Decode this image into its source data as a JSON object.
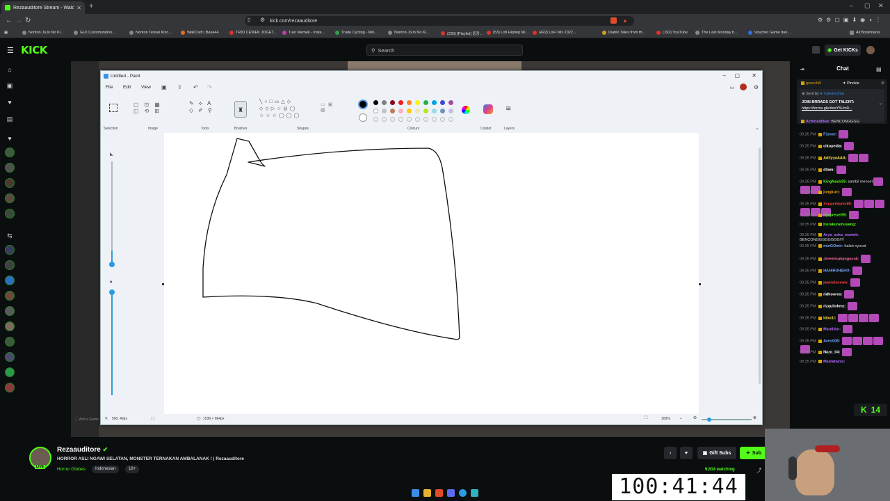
{
  "browser": {
    "tab_title": "Rezaauditore Stream - Watc",
    "url": "kick.com/rezaauditore",
    "bookmarks": [
      "Nonton JoJo No Ki...",
      "GUI Customization...",
      "Nonton Tensei Kizo...",
      "WallCraft | Base44",
      "TRIO CEWEK JOGET...",
      "Tuer Memek - Insta...",
      "Trade Cycling - Min...",
      "Nonton JoJo No Ki...",
      "(236) [Playlist] 중정...",
      "(53) Lofi Hiphop Mi...",
      "(422) LoFi Mix 2022...",
      "Diablo Tales from th...",
      "(192) YouTube",
      "The Last Monday b...",
      "Voucher Game dan..."
    ],
    "all_bookmarks": "All Bookmarks"
  },
  "kick": {
    "logo": "KICK",
    "search_placeholder": "Search",
    "get_kicks": "Get KICKs"
  },
  "paint": {
    "title": "Untitled - Paint",
    "menu": [
      "File",
      "Edit",
      "View"
    ],
    "groups": [
      "Selection",
      "Image",
      "Tools",
      "Brushes",
      "Shapes",
      "Colours",
      "Copilot",
      "Layers"
    ],
    "status_pos": "500, 49px",
    "status_size": "1536 × 864px",
    "zoom": "100%",
    "colors": [
      "#000000",
      "#7f7f7f",
      "#880015",
      "#ed1c24",
      "#ff7f27",
      "#fff200",
      "#22b14c",
      "#00a2e8",
      "#3f48cc",
      "#a349a4",
      "#ffffff",
      "#c3c3c3",
      "#b97a57",
      "#ffaec9",
      "#ffc90e",
      "#efe4b0",
      "#b5e61d",
      "#99d9ea",
      "#7092be",
      "#c8bfe7"
    ]
  },
  "chat": {
    "header": "Chat",
    "pinned_users": [
      "goonchill",
      "Pinckle"
    ],
    "pinned_sender": "Sent by",
    "pinned_text": "JOIN BRRADS GOT TALENT:",
    "pinned_link": "https://forms.gle/doxY5Um0...",
    "messages": [
      {
        "time": "",
        "user": "Achmadbkat:",
        "text": "BENCONGGGG",
        "color": "#b36bff",
        "emotes": 0
      },
      {
        "time": "09:35 PM",
        "user": "F1nxer:",
        "text": "",
        "color": "#7aa7ff",
        "emotes": 1
      },
      {
        "time": "09:35 PM",
        "user": "cikopedia:",
        "text": "",
        "color": "#fff",
        "emotes": 1
      },
      {
        "time": "09:35 PM",
        "user": "AdityyaAAA:",
        "text": "",
        "color": "#ffe14d",
        "emotes": 2
      },
      {
        "time": "09:35 PM",
        "user": "d0am:",
        "text": "",
        "color": "#fff",
        "emotes": 1
      },
      {
        "time": "09:35 PM",
        "user": "KingNasir25:",
        "text": "sambil mencet",
        "color": "#53fc18",
        "emotes": 3
      },
      {
        "time": "09:35 PM",
        "user": "jongkurr:",
        "text": "",
        "color": "#ffa500",
        "emotes": 1
      },
      {
        "time": "09:35 PM",
        "user": "XsuperSonic85:",
        "text": "",
        "color": "#ff4040",
        "emotes": 6
      },
      {
        "time": "09:35 PM",
        "user": "riyzpreset99:",
        "text": "",
        "color": "#53fc18",
        "emotes": 1
      },
      {
        "time": "09:35 PM",
        "user": "Kurakuramusang:",
        "text": "",
        "color": "#53fc18",
        "emotes": 0
      },
      {
        "time": "09:35 PM",
        "user": "Arya_suka_wowok:",
        "text": "BENCONGGGGGGGG!!!!",
        "color": "#b36bff",
        "emotes": 0
      },
      {
        "time": "09:35 PM",
        "user": "minGOmir:",
        "text": "halah nyocot",
        "color": "#7aa7ff",
        "emotes": 0
      },
      {
        "time": "09:35 PM",
        "user": "Jeremisukangocok:",
        "text": "",
        "color": "#ff6b9e",
        "emotes": 1
      },
      {
        "time": "09:35 PM",
        "user": "HAHIHUHEHO:",
        "text": "",
        "color": "#7aa7ff",
        "emotes": 1
      },
      {
        "time": "09:35 PM",
        "user": "jawirsinsewo:",
        "text": "",
        "color": "#ff4040",
        "emotes": 1
      },
      {
        "time": "09:35 PM",
        "user": "ridhooreo:",
        "text": "",
        "color": "#fff",
        "emotes": 1
      },
      {
        "time": "09:35 PM",
        "user": "rizquilohmz:",
        "text": "",
        "color": "#fff",
        "emotes": 1
      },
      {
        "time": "09:35 PM",
        "user": "Idoo1t:",
        "text": "",
        "color": "#ffe14d",
        "emotes": 4
      },
      {
        "time": "09:35 PM",
        "user": "Mautidur:",
        "text": "",
        "color": "#b36bff",
        "emotes": 1
      },
      {
        "time": "09:35 PM",
        "user": "Aves008:",
        "text": "",
        "color": "#7aa7ff",
        "emotes": 5
      },
      {
        "time": "09:35 PM",
        "user": "Nazo_04:",
        "text": "",
        "color": "#fff",
        "emotes": 1
      },
      {
        "time": "09:35 PM",
        "user": "Mamatwois:",
        "text": "",
        "color": "#b36bff",
        "emotes": 0
      }
    ],
    "kick_badge_count": "14"
  },
  "channel": {
    "name": "Rezaauditore",
    "title": "HORROR ASLI NGAWI SELATAN, MONSTER TERNAKAN AMBALANAK ! | Rezaauditore",
    "tags": [
      "Horror Globes",
      "Indonesian",
      "18+"
    ],
    "gift_subs": "Gift Subs",
    "subscribe": "Sub",
    "watching": "9,614 watching"
  },
  "overlay": {
    "timer": "100:41:44"
  }
}
